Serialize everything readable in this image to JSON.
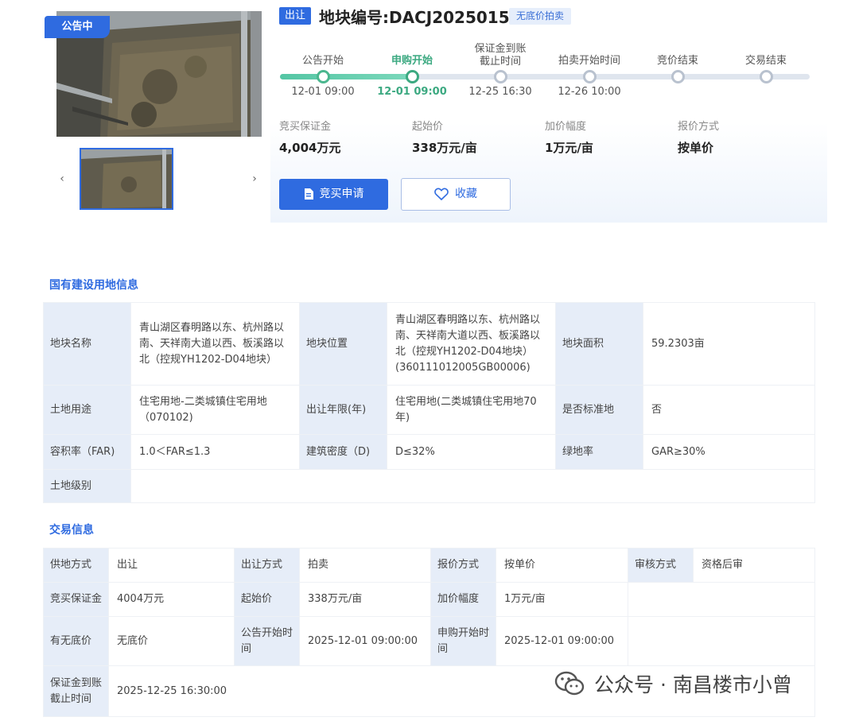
{
  "header": {
    "notice_badge": "公告中",
    "transfer_tag": "出让",
    "plot_title": "地块编号:DACJ2025015",
    "auction_tag": "无底价拍卖"
  },
  "timeline": {
    "steps": [
      {
        "label": "公告开始",
        "date": "12-01 09:00",
        "state": "done"
      },
      {
        "label": "申购开始",
        "date": "12-01 09:00",
        "state": "active"
      },
      {
        "label": "保证金到账\n截止时间",
        "date": "12-25 16:30",
        "state": "pending"
      },
      {
        "label": "拍卖开始时间",
        "date": "12-26 10:00",
        "state": "pending"
      },
      {
        "label": "竞价结束",
        "date": "",
        "state": "pending"
      },
      {
        "label": "交易结束",
        "date": "",
        "state": "pending"
      }
    ]
  },
  "stats": [
    {
      "label": "竞买保证金",
      "value": "4,004万元"
    },
    {
      "label": "起始价",
      "value": "338万元/亩"
    },
    {
      "label": "加价幅度",
      "value": "1万元/亩"
    },
    {
      "label": "报价方式",
      "value": "按单价"
    }
  ],
  "actions": {
    "apply_label": "竞买申请",
    "favorite_label": "收藏"
  },
  "land_info": {
    "title": "国有建设用地信息",
    "rows": [
      [
        {
          "k": "地块名称",
          "v": "青山湖区春明路以东、杭州路以南、天祥南大道以西、板溪路以北（控规YH1202-D04地块）"
        },
        {
          "k": "地块位置",
          "v": "青山湖区春明路以东、杭州路以南、天祥南大道以西、板溪路以北（控规YH1202-D04地块）(360111012005GB00006)"
        },
        {
          "k": "地块面积",
          "v": "59.2303亩"
        }
      ],
      [
        {
          "k": "土地用途",
          "v": "住宅用地-二类城镇住宅用地（070102)"
        },
        {
          "k": "出让年限(年)",
          "v": "住宅用地(二类城镇住宅用地70年)"
        },
        {
          "k": "是否标准地",
          "v": "否"
        }
      ],
      [
        {
          "k": "容积率（FAR)",
          "v": "1.0＜FAR≤1.3"
        },
        {
          "k": "建筑密度（D)",
          "v": "D≤32%"
        },
        {
          "k": "绿地率",
          "v": "GAR≥30%"
        }
      ],
      [
        {
          "k": "土地级别",
          "v": ""
        }
      ]
    ]
  },
  "trade_info": {
    "title": "交易信息",
    "rows": [
      [
        {
          "k": "供地方式",
          "v": "出让"
        },
        {
          "k": "出让方式",
          "v": "拍卖"
        },
        {
          "k": "报价方式",
          "v": "按单价"
        },
        {
          "k": "审核方式",
          "v": "资格后审"
        }
      ],
      [
        {
          "k": "竞买保证金",
          "v": "4004万元"
        },
        {
          "k": "起始价",
          "v": "338万元/亩"
        },
        {
          "k": "加价幅度",
          "v": "1万元/亩"
        }
      ],
      [
        {
          "k": "有无底价",
          "v": "无底价"
        },
        {
          "k": "公告开始时间",
          "v": "2025-12-01 09:00:00"
        },
        {
          "k": "申购开始时间",
          "v": "2025-12-01 09:00:00"
        }
      ],
      [
        {
          "k": "保证金到账截止时间",
          "v": "2025-12-25 16:30:00"
        }
      ]
    ]
  },
  "watermark": {
    "text": "公众号 · 南昌楼市小曾"
  },
  "colors": {
    "primary": "#2f6be0",
    "progress": "#4bb78f",
    "key_cell_bg": "#e6edf8"
  }
}
